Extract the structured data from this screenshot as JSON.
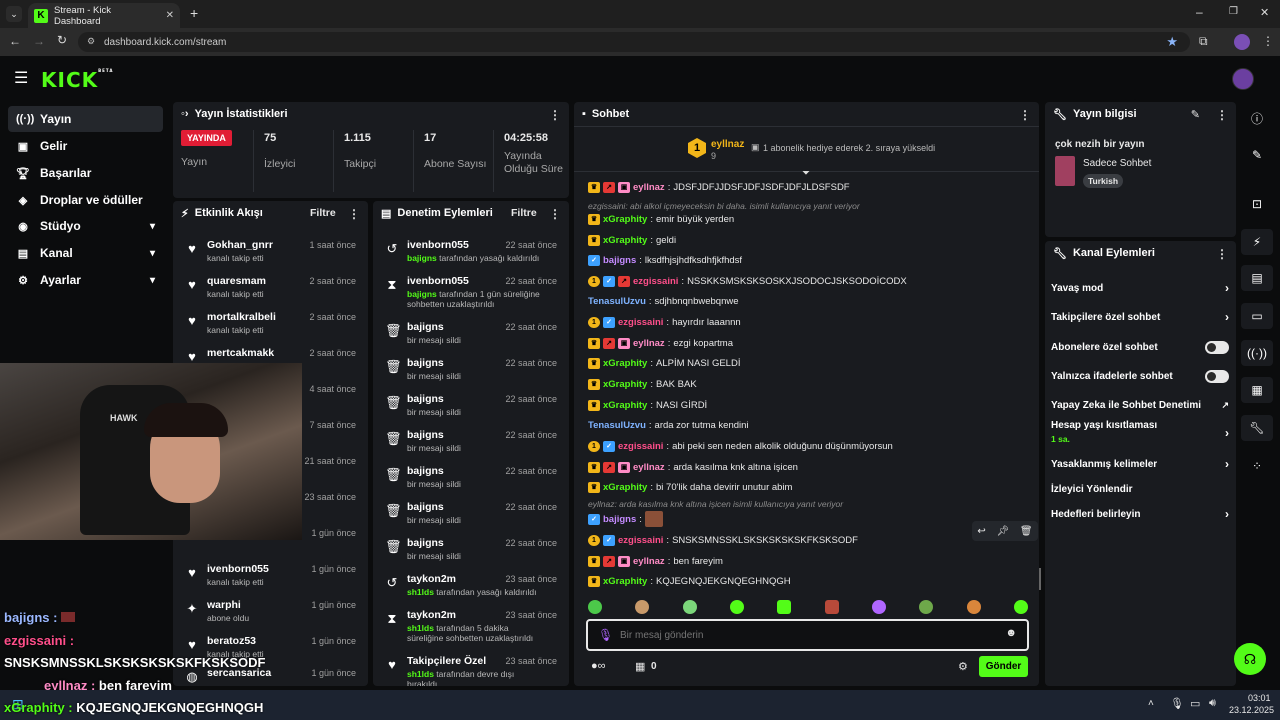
{
  "browser": {
    "tab_title": "Stream - Kick Dashboard",
    "url": "dashboard.kick.com/stream"
  },
  "header": {
    "logo": "KICK",
    "beta": "BETA"
  },
  "sidebar": {
    "items": [
      {
        "label": "Yayın",
        "icon": "live-icon"
      },
      {
        "label": "Gelir",
        "icon": "wallet-icon"
      },
      {
        "label": "Başarılar",
        "icon": "trophy-icon"
      },
      {
        "label": "Droplar ve ödüller",
        "icon": "drops-icon"
      },
      {
        "label": "Stüdyo",
        "icon": "studio-icon"
      },
      {
        "label": "Kanal",
        "icon": "channel-icon"
      },
      {
        "label": "Ayarlar",
        "icon": "gear-icon"
      }
    ]
  },
  "stats": {
    "title": "Yayın İstatistikleri",
    "live": "YAYINDA",
    "live_label": "Yayın",
    "viewers": "75",
    "viewers_label": "İzleyici",
    "followers": "1.115",
    "followers_label": "Takipçi",
    "subs": "17",
    "subs_label": "Abone Sayısı",
    "duration": "04:25:58",
    "duration_label": "Yayında Olduğu Süre"
  },
  "activity": {
    "title": "Etkinlik Akışı",
    "filter": "Filtre",
    "items": [
      {
        "name": "Gokhan_gnrr",
        "sub": "kanalı takip etti",
        "time": "1 saat önce"
      },
      {
        "name": "quaresmam",
        "sub": "kanalı takip etti",
        "time": "2 saat önce"
      },
      {
        "name": "mortalkralbeli",
        "sub": "kanalı takip etti",
        "time": "2 saat önce"
      },
      {
        "name": "mertcakmakk",
        "sub": "kanalı takip etti",
        "time": "2 saat önce"
      },
      {
        "name": "",
        "sub": "",
        "time": "4 saat önce"
      },
      {
        "name": "",
        "sub": "",
        "time": "7 saat önce"
      },
      {
        "name": "",
        "sub": "",
        "time": "21 saat önce"
      },
      {
        "name": "",
        "sub": "",
        "time": "23 saat önce"
      },
      {
        "name": "",
        "sub": "",
        "time": "1 gün önce"
      },
      {
        "name": "ivenborn055",
        "sub": "kanalı takip etti",
        "time": "1 gün önce"
      },
      {
        "name": "warphi",
        "sub": "abone oldu",
        "time": "1 gün önce"
      },
      {
        "name": "beratoz53",
        "sub": "kanalı takip etti",
        "time": "1 gün önce"
      },
      {
        "name": "sercansarica",
        "sub": "",
        "time": "1 gün önce"
      }
    ]
  },
  "mod": {
    "title": "Denetim Eylemleri",
    "filter": "Filtre",
    "items": [
      {
        "icon": "undo-icon",
        "name": "ivenborn055",
        "who": "bajigns",
        "sub": " tarafından yasağı kaldırıldı",
        "time": "22 saat önce"
      },
      {
        "icon": "hourglass-icon",
        "name": "ivenborn055",
        "who": "bajigns",
        "sub": " tarafından 1 gün süreliğine sohbetten uzaklaştırıldı",
        "time": "22 saat önce"
      },
      {
        "icon": "trash-icon",
        "name": "bajigns",
        "who": "",
        "sub": "bir mesajı sildi",
        "time": "22 saat önce"
      },
      {
        "icon": "trash-icon",
        "name": "bajigns",
        "who": "",
        "sub": "bir mesajı sildi",
        "time": "22 saat önce"
      },
      {
        "icon": "trash-icon",
        "name": "bajigns",
        "who": "",
        "sub": "bir mesajı sildi",
        "time": "22 saat önce"
      },
      {
        "icon": "trash-icon",
        "name": "bajigns",
        "who": "",
        "sub": "bir mesajı sildi",
        "time": "22 saat önce"
      },
      {
        "icon": "trash-icon",
        "name": "bajigns",
        "who": "",
        "sub": "bir mesajı sildi",
        "time": "22 saat önce"
      },
      {
        "icon": "trash-icon",
        "name": "bajigns",
        "who": "",
        "sub": "bir mesajı sildi",
        "time": "22 saat önce"
      },
      {
        "icon": "trash-icon",
        "name": "bajigns",
        "who": "",
        "sub": "bir mesajı sildi",
        "time": "22 saat önce"
      },
      {
        "icon": "undo-icon",
        "name": "taykon2m",
        "who": "sh1lds",
        "sub": " tarafından yasağı kaldırıldı",
        "time": "23 saat önce"
      },
      {
        "icon": "hourglass-icon",
        "name": "taykon2m",
        "who": "sh1lds",
        "sub": " tarafından 5 dakika süreliğine sohbetten uzaklaştırıldı",
        "time": "23 saat önce"
      },
      {
        "icon": "heart-icon",
        "name": "Takipçilere Özel",
        "who": "sh1lds",
        "sub": " tarafından devre dışı bırakıldı",
        "time": "23 saat önce"
      }
    ]
  },
  "chat": {
    "title": "Sohbet",
    "pinned_user": "eyllnaz",
    "pinned_count": "9",
    "pinned_msg": "1 abonelik hediye ederek 2. sıraya yükseldi",
    "messages": [
      {
        "t": "msg",
        "badges": [
          "crown",
          "sub",
          "gift"
        ],
        "user": "eyllnaz",
        "color": "#ff8cc6",
        "text": "JDSFJDFJJDSFJDFJSDFJDFJLDSFSDF"
      },
      {
        "t": "reply",
        "text": "ezgissaini: abi alkol içmeyeceksin bi daha. isimli kullanıcıya yanıt veriyor"
      },
      {
        "t": "msg",
        "badges": [
          "crown"
        ],
        "user": "xGraphity",
        "color": "#53fc18",
        "text": "emir büyük yerden"
      },
      {
        "t": "msg",
        "badges": [
          "crown"
        ],
        "user": "xGraphity",
        "color": "#53fc18",
        "text": "geldi"
      },
      {
        "t": "msg",
        "badges": [
          "verif"
        ],
        "user": "bajigns",
        "color": "#c48bff",
        "text": "lksdfhjsjhdfksdhfjkfhdsf"
      },
      {
        "t": "msg",
        "badges": [
          "one",
          "verif",
          "sub"
        ],
        "user": "ezgissaini",
        "color": "#ff4f8b",
        "text": "NSSKKSMSKSKSOSKXJSODOCJSKSODOİCODX"
      },
      {
        "t": "msg",
        "badges": [],
        "user": "TenasulUzvu",
        "color": "#7fb3ff",
        "text": "sdjhbnqnbwebqnwe"
      },
      {
        "t": "msg",
        "badges": [
          "one",
          "verif"
        ],
        "user": "ezgissaini",
        "color": "#ff4f8b",
        "text": "hayırdır laaannn"
      },
      {
        "t": "msg",
        "badges": [
          "crown",
          "sub",
          "gift"
        ],
        "user": "eyllnaz",
        "color": "#ff8cc6",
        "text": "ezgi kopartma"
      },
      {
        "t": "msg",
        "badges": [
          "crown"
        ],
        "user": "xGraphity",
        "color": "#53fc18",
        "text": "ALPİM NASI GELDİ"
      },
      {
        "t": "msg",
        "badges": [
          "crown"
        ],
        "user": "xGraphity",
        "color": "#53fc18",
        "text": "BAK BAK"
      },
      {
        "t": "msg",
        "badges": [
          "crown"
        ],
        "user": "xGraphity",
        "color": "#53fc18",
        "text": "NASI GİRDİ"
      },
      {
        "t": "msg",
        "badges": [],
        "user": "TenasulUzvu",
        "color": "#7fb3ff",
        "text": "arda zor tutma kendini"
      },
      {
        "t": "msg",
        "badges": [
          "one",
          "verif"
        ],
        "user": "ezgissaini",
        "color": "#ff4f8b",
        "text": "abi peki sen neden alkolik olduğunu düşünmüyorsun"
      },
      {
        "t": "msg",
        "badges": [
          "crown",
          "sub",
          "gift"
        ],
        "user": "eyllnaz",
        "color": "#ff8cc6",
        "text": "arda kasılma knk altına işicen"
      },
      {
        "t": "msg",
        "badges": [
          "crown"
        ],
        "user": "xGraphity",
        "color": "#53fc18",
        "text": "bi 70'lik daha devirir unutur abim"
      },
      {
        "t": "reply",
        "text": "eyllnaz: arda kasılma knk altına işicen isimli kullanıcıya yanıt veriyor"
      },
      {
        "t": "msg",
        "badges": [
          "verif"
        ],
        "user": "bajigns",
        "color": "#c48bff",
        "text": "",
        "img": true
      },
      {
        "t": "msg",
        "badges": [
          "one",
          "verif"
        ],
        "user": "ezgissaini",
        "color": "#ff4f8b",
        "text": "SNSKSMNSSKLSKSKSKSKSKFKSKSODF"
      },
      {
        "t": "msg",
        "badges": [
          "crown",
          "sub",
          "gift"
        ],
        "user": "eyllnaz",
        "color": "#ff8cc6",
        "text": "ben fareyim"
      },
      {
        "t": "msg",
        "badges": [
          "crown"
        ],
        "user": "xGraphity",
        "color": "#53fc18",
        "text": "KQJEGNQJEKGNQEGHNQGH"
      }
    ],
    "input_placeholder": "Bir mesaj gönderin",
    "send": "Gönder",
    "count": "0"
  },
  "info": {
    "title": "Yayın bilgisi",
    "stream_title": "çok nezih bir yayın",
    "category": "Sadece Sohbet",
    "language": "Turkish"
  },
  "actions": {
    "title": "Kanal Eylemleri",
    "items": [
      {
        "label": "Yavaş mod",
        "ctrl": "chevron"
      },
      {
        "label": "Takipçilere özel sohbet",
        "ctrl": "chevron"
      },
      {
        "label": "Abonelere özel sohbet",
        "ctrl": "toggle"
      },
      {
        "label": "Yalnızca ifadelerle sohbet",
        "ctrl": "toggle"
      },
      {
        "label": "Yapay Zeka ile Sohbet Denetimi",
        "ctrl": "external"
      },
      {
        "label": "Hesap yaşı kısıtlaması",
        "ctrl": "chevron",
        "sub": "1 sa."
      },
      {
        "label": "Yasaklanmış kelimeler",
        "ctrl": "chevron"
      },
      {
        "label": "İzleyici Yönlendir",
        "ctrl": ""
      },
      {
        "label": "Hedefleri belirleyin",
        "ctrl": "chevron"
      }
    ]
  },
  "overlay": {
    "l1user": "bajigns :",
    "l2user": "ezgissaini :",
    "l3": "SNSKSMNSSKLSKSKSKSKSKFKSKSODF",
    "l4user": "eyllnaz :",
    "l4text": "ben fareyim",
    "l5user": "xGraphity :",
    "l5text": "KQJEGNQJEKGNQEGHNQGH",
    "cap": "HAWK"
  },
  "taskbar": {
    "time": "03:01",
    "date": "23.12.2025"
  },
  "colors": {
    "accent": "#53fc18",
    "panel": "#191b1f",
    "live": "#e11d35"
  }
}
